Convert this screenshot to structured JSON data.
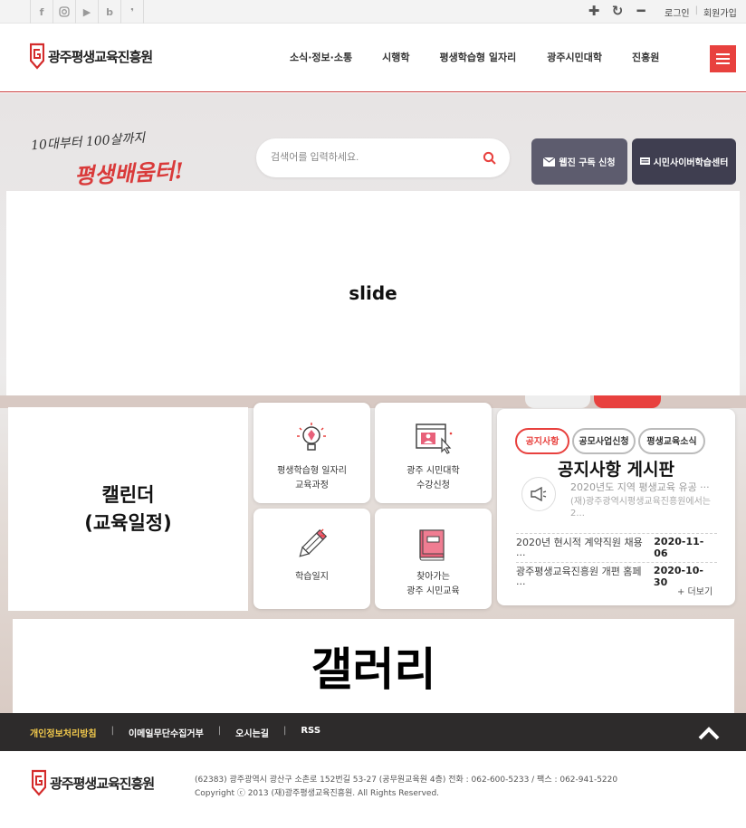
{
  "topbar": {
    "sns": [
      "facebook-icon",
      "instagram-icon",
      "youtube-icon",
      "blog-icon",
      "kakao-icon"
    ],
    "zoom": [
      "zoom-in-icon",
      "refresh-icon",
      "zoom-out-icon"
    ],
    "login": "로그인",
    "join": "회원가입"
  },
  "header": {
    "logo_text": "광주평생교육진흥원",
    "nav": [
      "소식·정보·소통",
      "시행학",
      "평생학습형 일자리",
      "광주시민대학",
      "진흥원"
    ],
    "accent": "#e8413e"
  },
  "visual": {
    "slogan_line1": "10대부터 100살까지",
    "slogan_line2": "평생배움터!",
    "search_placeholder": "검색어를 입력하세요.",
    "webzine": "웹진 구독 신청",
    "cyber": "시민사이버학습센터",
    "slide": "slide",
    "calendar_line1": "캘린더",
    "calendar_line2": "(교육일정)",
    "gallery": "갤러리"
  },
  "tiles": [
    {
      "line1": "평생학습형 일자리",
      "line2": "교육과정"
    },
    {
      "line1": "광주 시민대학",
      "line2": "수강신청"
    },
    {
      "line1": "학습일지",
      "line2": ""
    },
    {
      "line1": "찾아가는",
      "line2": "광주 시민교육"
    }
  ],
  "notice": {
    "tabs": [
      "공지사항",
      "공모사업신청",
      "평생교육소식"
    ],
    "title": "공지사항 게시판",
    "featured_title": "2020년도 지역 평생교육 유공 ···",
    "featured_desc": "(재)광주광역시평생교육진흥원에서는 2...",
    "items": [
      {
        "title": "2020년 현시적 계약직원 채용 ···",
        "date": "2020-11-06"
      },
      {
        "title": "광주평생교육진흥원 개편 홈페 ···",
        "date": "2020-10-30"
      }
    ],
    "more": "+ 더보기"
  },
  "footer": {
    "links": [
      "개인정보처리방침",
      "이메일무단수집거부",
      "오시는길",
      "RSS"
    ],
    "highlight": "#f2c94c",
    "logo_text": "광주평생교육진흥원",
    "address": "(62383) 광주광역시 광산구 소촌로 152번길 53-27 (공무원교육원 4층) 전화 : 062-600-5233 / 팩스 : 062-941-5220",
    "copyright": "Copyright ⓒ 2013 (재)광주평생교육진흥원. All Rights Reserved."
  }
}
